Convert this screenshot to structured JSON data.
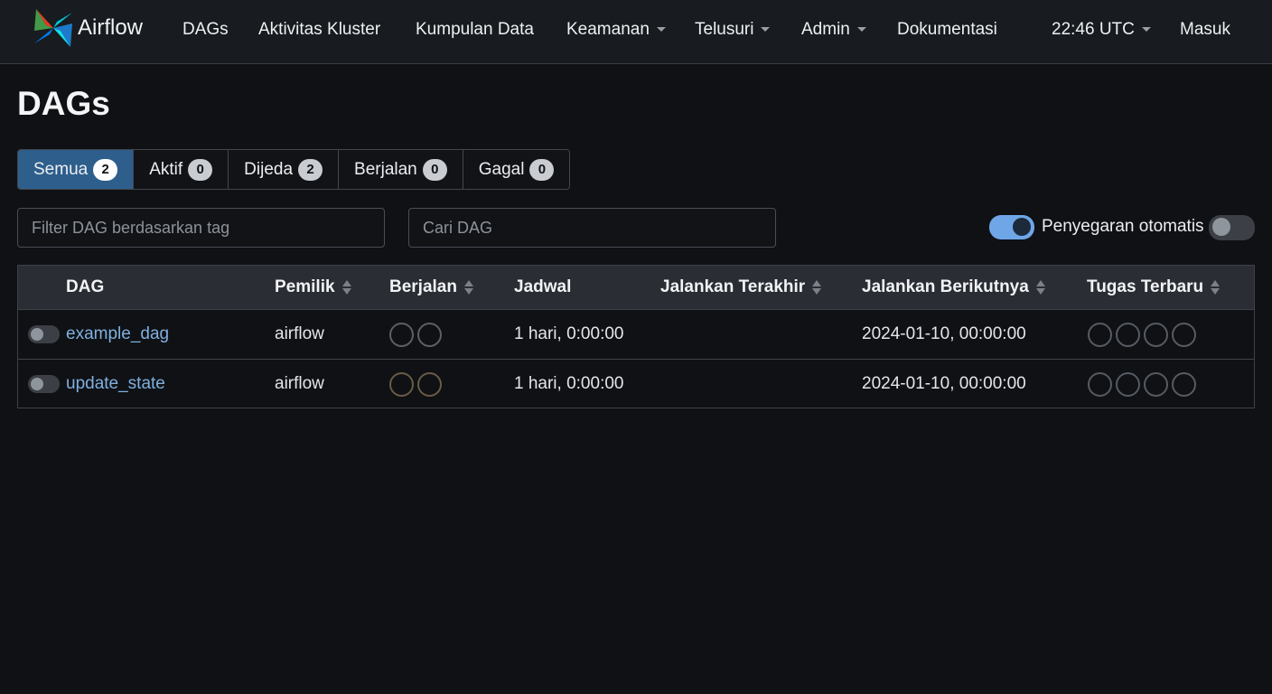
{
  "navbar": {
    "brand": "Airflow",
    "items": [
      {
        "label": "DAGs",
        "dropdown": false
      },
      {
        "label": "Aktivitas Kluster",
        "dropdown": false
      },
      {
        "label": "Kumpulan Data",
        "dropdown": false
      },
      {
        "label": "Keamanan",
        "dropdown": true
      },
      {
        "label": "Telusuri",
        "dropdown": true
      },
      {
        "label": "Admin",
        "dropdown": true
      },
      {
        "label": "Dokumentasi",
        "dropdown": false
      }
    ],
    "time": "22:46 UTC",
    "login": "Masuk"
  },
  "page_title": "DAGs",
  "tabs": [
    {
      "label": "Semua",
      "count": "2",
      "active": true
    },
    {
      "label": "Aktif",
      "count": "0",
      "active": false
    },
    {
      "label": "Dijeda",
      "count": "2",
      "active": false
    },
    {
      "label": "Berjalan",
      "count": "0",
      "active": false
    },
    {
      "label": "Gagal",
      "count": "0",
      "active": false
    }
  ],
  "filters": {
    "tag_placeholder": "Filter DAG berdasarkan tag",
    "search_placeholder": "Cari DAG",
    "auto_refresh_label": "Penyegaran otomatis",
    "auto_refresh_on": true
  },
  "table": {
    "headers": {
      "dag": "DAG",
      "owner": "Pemilik",
      "runs": "Berjalan",
      "schedule": "Jadwal",
      "last_run": "Jalankan Terakhir",
      "next_run": "Jalankan Berikutnya",
      "recent_tasks": "Tugas Terbaru"
    },
    "rows": [
      {
        "dag_id": "example_dag",
        "owner": "airflow",
        "schedule": "1 hari, 0:00:00",
        "last_run": "",
        "next_run": "2024-01-10, 00:00:00",
        "paused": true
      },
      {
        "dag_id": "update_state",
        "owner": "airflow",
        "schedule": "1 hari, 0:00:00",
        "last_run": "",
        "next_run": "2024-01-10, 00:00:00",
        "paused": true
      }
    ]
  },
  "colors": {
    "accent": "#2d5e8c",
    "link": "#7fb0e0",
    "toggle_on": "#6fa6e8",
    "background": "#0f1114"
  }
}
